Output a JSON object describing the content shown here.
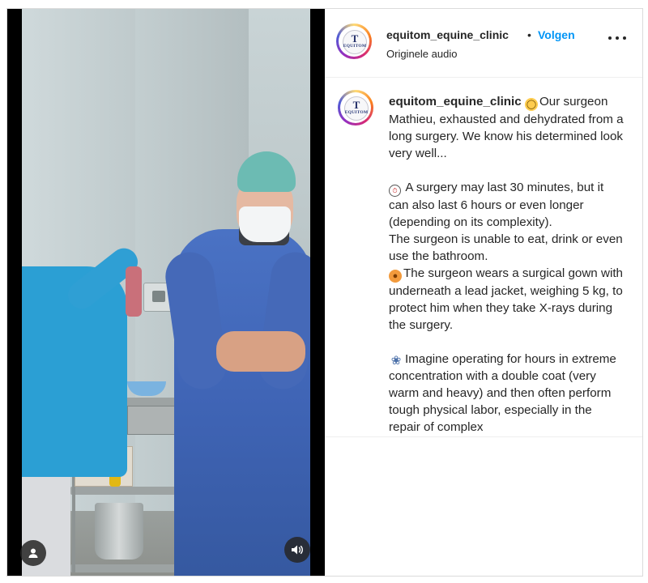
{
  "post": {
    "username": "equitom_equine_clinic",
    "separator": "•",
    "follow_label": "Volgen",
    "audio_label": "Originele audio",
    "avatar_text_top": "T",
    "avatar_text": "EQUITOM"
  },
  "caption": {
    "username": "equitom_equine_clinic",
    "line1": "Our surgeon Mathieu, exhausted and dehydrated from a long surgery. We know his determined look very well...",
    "line2": "A surgery may last 30 minutes, but it can also last 6 hours or even longer (depending on its complexity).",
    "line3": "The surgeon is unable to eat, drink or even use the bathroom.",
    "line4": "The surgeon wears a surgical gown with underneath a lead jacket, weighing 5 kg, to protect him when they take X-rays during the surgery.",
    "line5": "Imagine operating for hours in extreme concentration with a double coat (very warm and heavy) and then often perform tough physical labor, especially in the repair of complex"
  },
  "icons": {
    "more": "more-horizontal-icon",
    "user_tag": "user-icon",
    "sound": "speaker-icon",
    "emoji1": "mask-face-emoji",
    "emoji2": "stopwatch-emoji",
    "emoji3": "hot-face-emoji",
    "emoji4": "stethoscope-emoji"
  },
  "colors": {
    "follow": "#0095f6",
    "text": "#262626",
    "border": "#dbdbdb"
  }
}
